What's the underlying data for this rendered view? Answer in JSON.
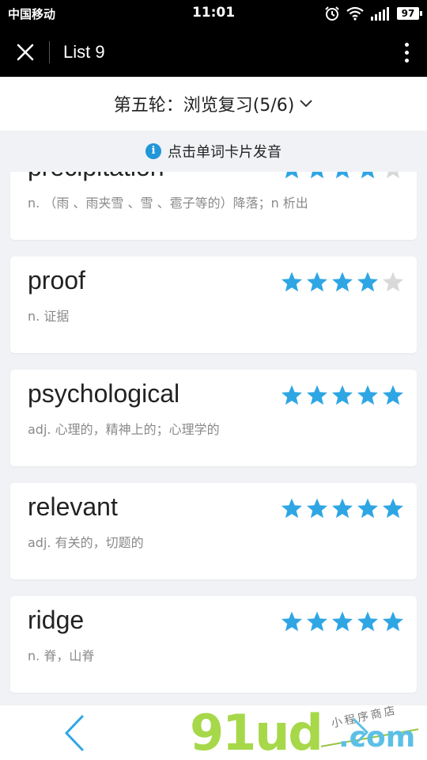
{
  "status_bar": {
    "carrier": "中国移动",
    "time": "11:01",
    "battery": "97"
  },
  "nav": {
    "title": "List 9"
  },
  "round": {
    "title": "第五轮：浏览复习(5/6)"
  },
  "tip": {
    "text": "点击单词卡片发音"
  },
  "colors": {
    "star_on": "#2fa6e4",
    "star_off": "#d9d9d9",
    "info": "#2196d9"
  },
  "words": [
    {
      "word": "precipitation",
      "meaning": "n. （雨 、雨夹雪 、雪 、雹子等的）降落；n 析出",
      "stars": 4
    },
    {
      "word": "proof",
      "meaning": "n. 证据",
      "stars": 4
    },
    {
      "word": "psychological",
      "meaning": "adj. 心理的，精神上的；心理学的",
      "stars": 5
    },
    {
      "word": "relevant",
      "meaning": "adj. 有关的，切题的",
      "stars": 5
    },
    {
      "word": "ridge",
      "meaning": "n. 脊，山脊",
      "stars": 5
    }
  ],
  "watermark": {
    "main": "91ud",
    "domain": ".com",
    "small": "小程序商店"
  }
}
